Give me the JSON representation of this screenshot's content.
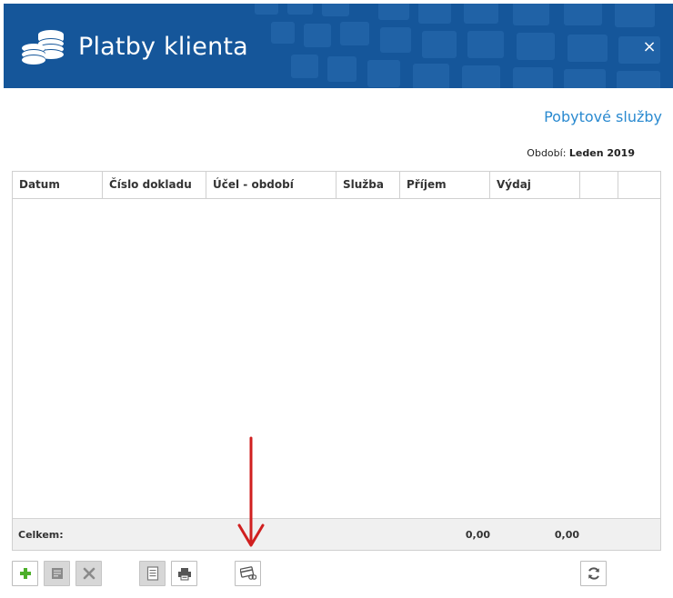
{
  "header": {
    "title": "Platby klienta",
    "close_label": "×",
    "background_color": "#15569a"
  },
  "section_link": "Pobytové služby",
  "period": {
    "label": "Období:",
    "value": "Leden 2019"
  },
  "table": {
    "columns": [
      "Datum",
      "Číslo dokladu",
      "Účel - období",
      "Služba",
      "Příjem",
      "Výdaj",
      "",
      ""
    ],
    "rows": [],
    "footer": {
      "label": "Celkem:",
      "prijem_total": "0,00",
      "vydaj_total": "0,00"
    }
  },
  "toolbar": {
    "add": {
      "icon": "plus-icon",
      "enabled": true
    },
    "edit": {
      "icon": "edit-document-icon",
      "enabled": false
    },
    "delete": {
      "icon": "close-icon",
      "enabled": false
    },
    "detail": {
      "icon": "document-icon",
      "enabled": false
    },
    "print": {
      "icon": "printer-icon",
      "enabled": true
    },
    "card_payment": {
      "icon": "card-payment-icon",
      "enabled": true
    },
    "refresh": {
      "icon": "refresh-icon",
      "enabled": true
    }
  },
  "annotation": {
    "icon": "red-arrow-down",
    "color": "#d01f1f"
  }
}
